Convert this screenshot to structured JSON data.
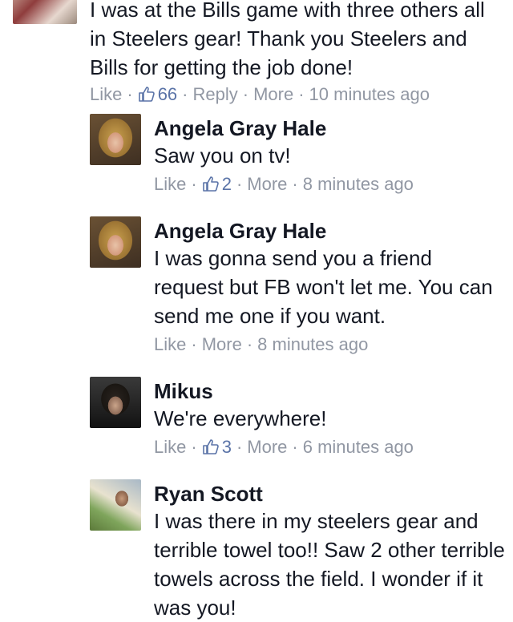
{
  "top_comment": {
    "text": "I was at the Bills game with three others all in Steelers gear! Thank you Steelers and Bills for getting the job done!",
    "like_label": "Like",
    "like_count": "66",
    "reply_label": "Reply",
    "more_label": "More",
    "time": "10 minutes ago"
  },
  "replies": [
    {
      "author": "Angela Gray Hale",
      "text": "Saw you on tv!",
      "like_label": "Like",
      "like_count": "2",
      "more_label": "More",
      "time": "8 minutes ago"
    },
    {
      "author": "Angela Gray Hale",
      "text": "I was gonna send you a friend request but FB won't let me. You can send me one if you want.",
      "like_label": "Like",
      "more_label": "More",
      "time": "8 minutes ago"
    },
    {
      "author": "Mikus",
      "text": "We're everywhere!",
      "like_label": "Like",
      "like_count": "3",
      "more_label": "More",
      "time": "6 minutes ago"
    },
    {
      "author": "Ryan Scott",
      "text": "I was there in my steelers gear and terrible towel too!! Saw 2 other terrible towels across the field. I wonder if it was you!"
    }
  ],
  "icons": {
    "thumb": "thumbs-up-icon"
  },
  "colors": {
    "meta": "#9197a3",
    "like_count": "#5b74a8",
    "text": "#141823"
  }
}
